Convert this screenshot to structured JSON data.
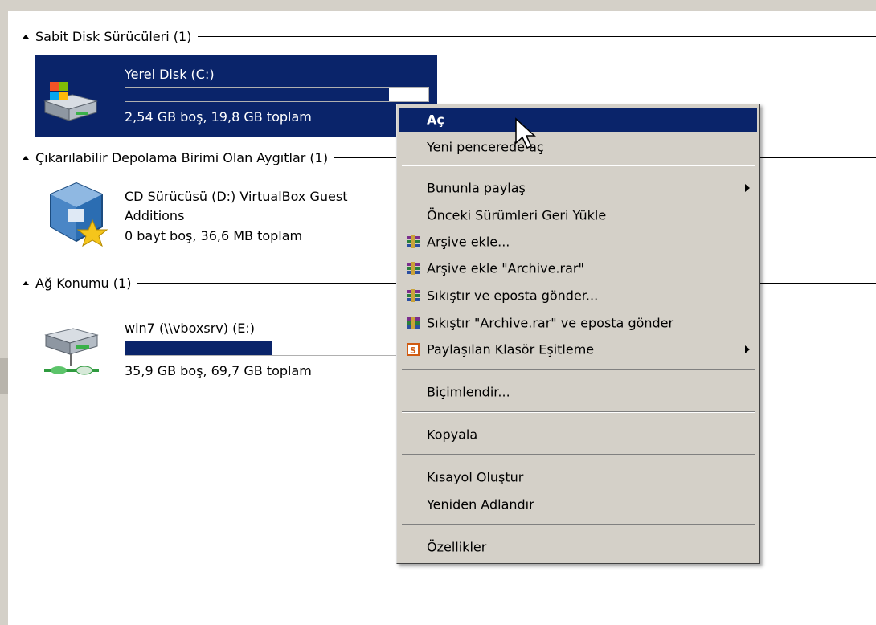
{
  "groups": {
    "hard_disks": {
      "title": "Sabit Disk Sürücüleri (1)"
    },
    "removable": {
      "title": "Çıkarılabilir Depolama Birimi Olan Aygıtlar (1)"
    },
    "network": {
      "title": "Ağ Konumu (1)"
    }
  },
  "drives": {
    "c": {
      "name": "Yerel Disk (C:)",
      "info": "2,54 GB boş, 19,8 GB toplam",
      "used_fraction": 0.87
    },
    "d": {
      "name_line1": "CD Sürücüsü (D:) VirtualBox Guest",
      "name_line2": "Additions",
      "info": "0 bayt boş, 36,6 MB toplam"
    },
    "e": {
      "name": "win7 (\\\\vboxsrv) (E:)",
      "info": "35,9 GB boş, 69,7 GB toplam",
      "used_fraction": 0.485
    }
  },
  "context_menu": {
    "open": "Aç",
    "open_new_window": "Yeni pencerede aç",
    "share_with": "Bununla paylaş",
    "restore_versions": "Önceki Sürümleri Geri Yükle",
    "add_archive": "Arşive ekle...",
    "add_archive_rar": "Arşive ekle \"Archive.rar\"",
    "compress_email": "Sıkıştır ve eposta gönder...",
    "compress_rar_email": "Sıkıştır \"Archive.rar\" ve eposta gönder",
    "sync_shared_folder": "Paylaşılan Klasör Eşitleme",
    "format": "Biçimlendir...",
    "copy": "Kopyala",
    "create_shortcut": "Kısayol Oluştur",
    "rename": "Yeniden Adlandır",
    "properties": "Özellikler"
  },
  "colors": {
    "selection": "#0a246a",
    "menu_bg": "#d4d0c8"
  }
}
